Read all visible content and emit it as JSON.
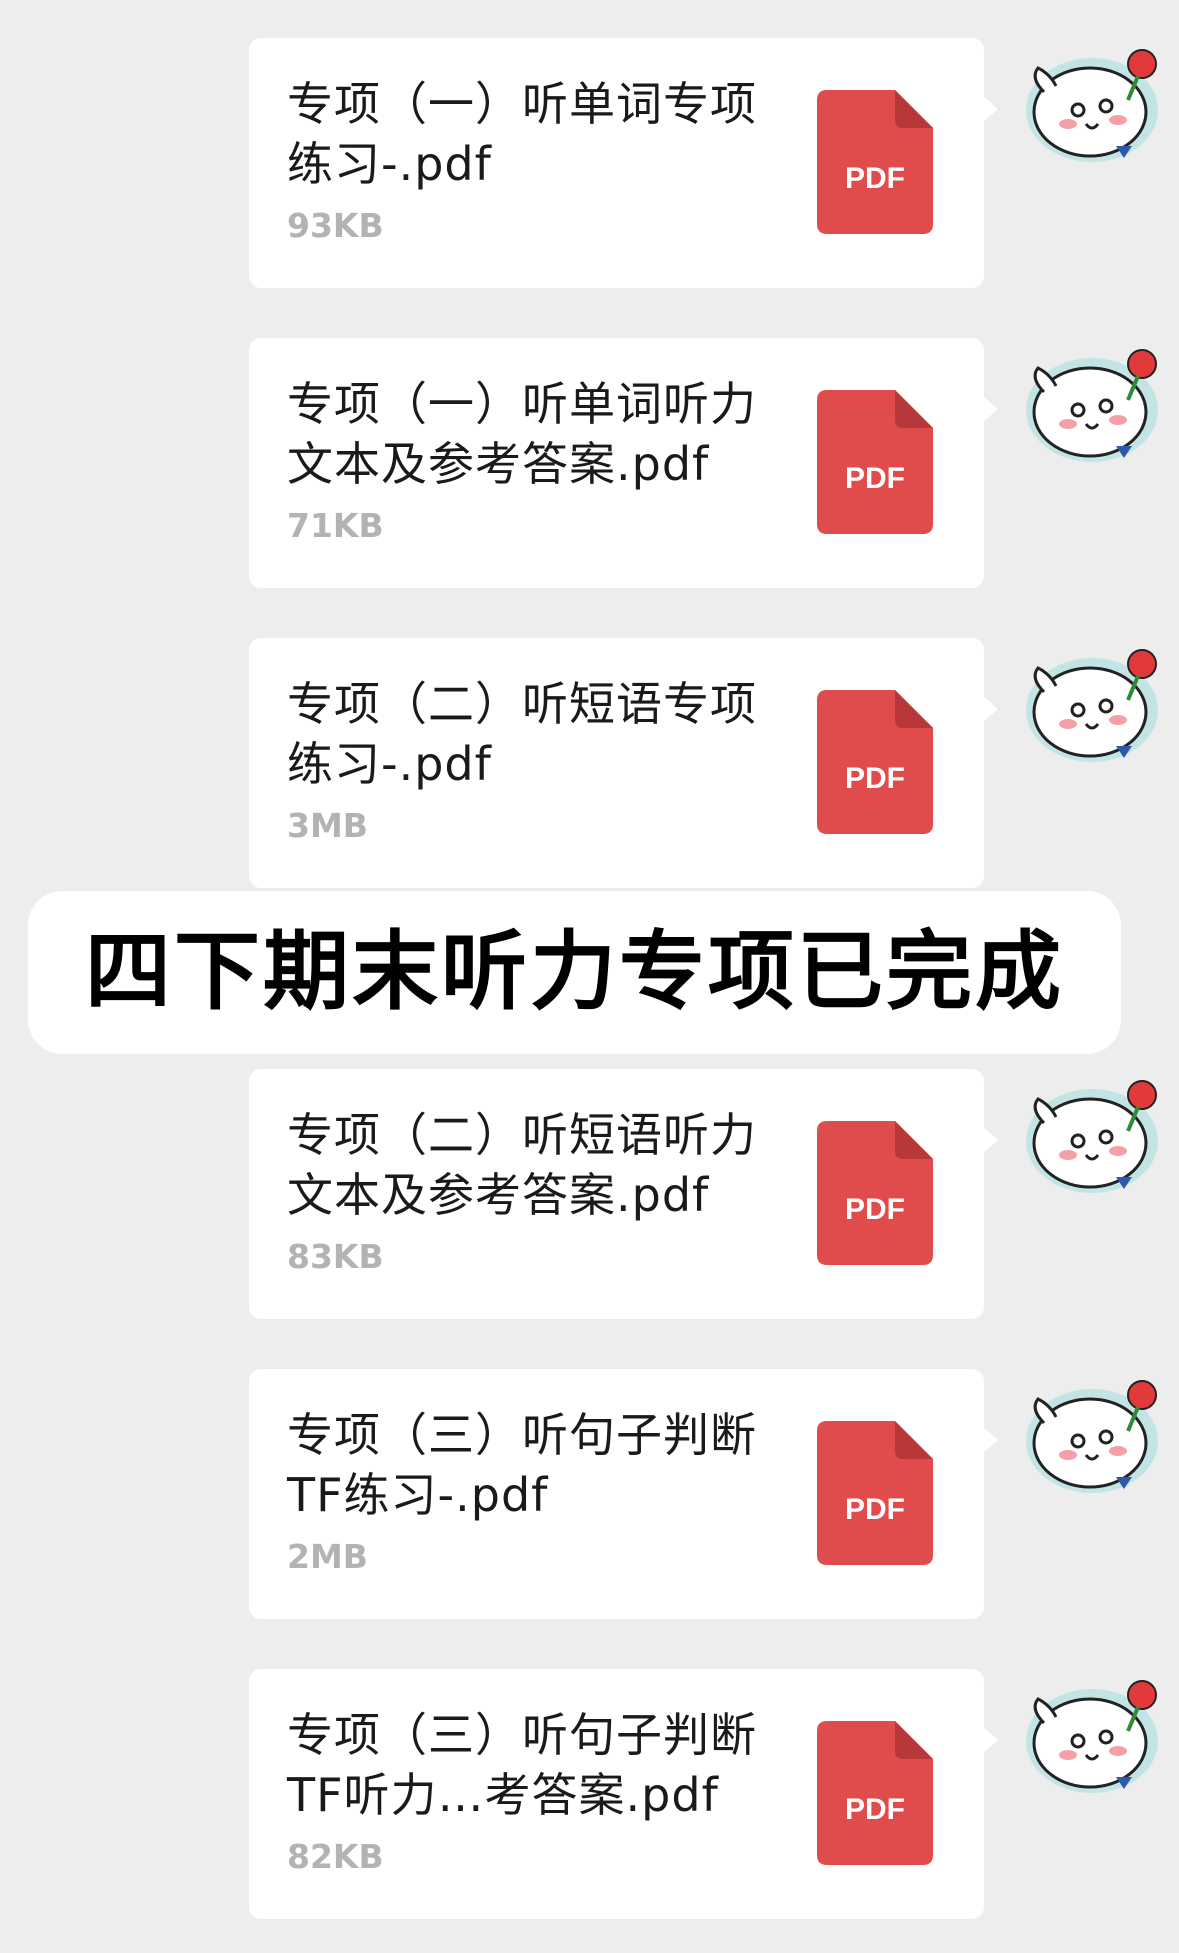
{
  "files": [
    {
      "name": "专项（一）听单词专项\n练习-.pdf",
      "size": "93KB",
      "type": "PDF"
    },
    {
      "name": "专项（一）听单词听力\n文本及参考答案.pdf",
      "size": "71KB",
      "type": "PDF"
    },
    {
      "name": "专项（二）听短语专项\n练习-.pdf",
      "size": "3MB",
      "type": "PDF"
    },
    {
      "name": "专项（二）听短语听力\n文本及参考答案.pdf",
      "size": "83KB",
      "type": "PDF"
    },
    {
      "name": "专项（三）听句子判断\nTF练习-.pdf",
      "size": "2MB",
      "type": "PDF"
    },
    {
      "name": "专项（三）听句子判断\nTF听力…考答案.pdf",
      "size": "82KB",
      "type": "PDF"
    }
  ],
  "banner": {
    "text": "四下期末听力专项已完成"
  },
  "colors": {
    "background": "#ededed",
    "bubble": "#ffffff",
    "pdf_icon": "#e04b4c",
    "size_text": "#b3b3b3"
  },
  "icons": {
    "file": "pdf-file-icon",
    "avatar": "cartoon-dog-with-rose-sticker-avatar"
  }
}
